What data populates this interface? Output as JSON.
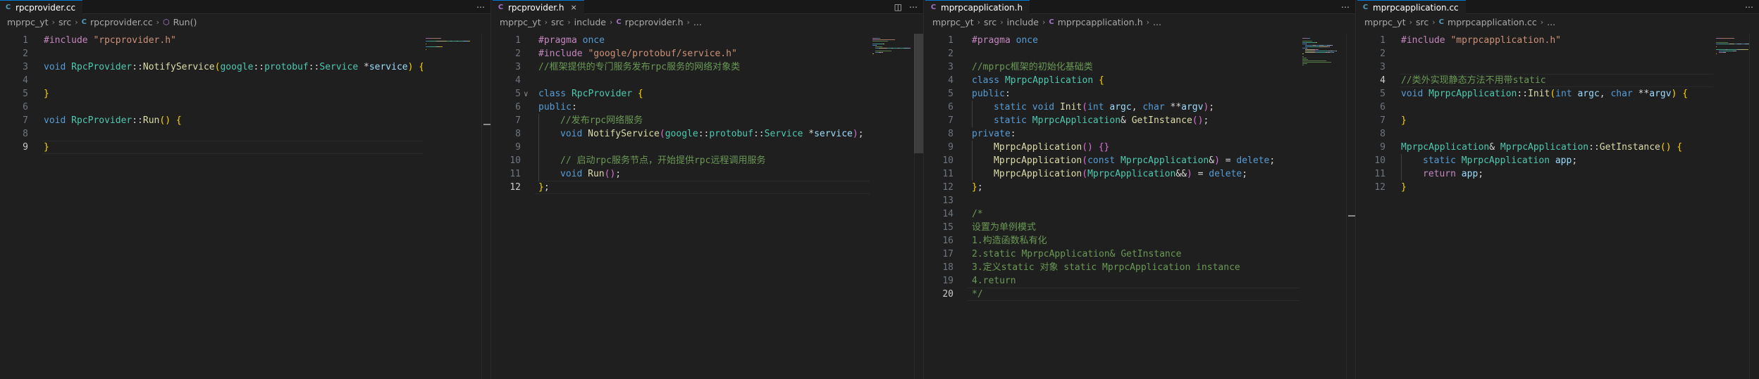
{
  "panes": [
    {
      "tab": {
        "icon": "C",
        "icon_kind": "cpp",
        "label": "rpcprovider.cc",
        "close": ""
      },
      "actions": [
        "⋯"
      ],
      "breadcrumb": [
        {
          "text": "mprpc_yt"
        },
        {
          "text": "src"
        },
        {
          "text": "rpcprovider.cc",
          "icon": "C",
          "icon_kind": "cpp"
        },
        {
          "text": "Run()",
          "icon": "⬡",
          "icon_kind": "sym"
        }
      ],
      "current_line": 9,
      "lines": [
        {
          "n": "1",
          "fold": "",
          "indent": 0,
          "tokens": [
            [
              "#include ",
              "pre"
            ],
            [
              "\"rpcprovider.h\"",
              "str"
            ]
          ]
        },
        {
          "n": "2",
          "fold": "",
          "indent": 0,
          "tokens": []
        },
        {
          "n": "3",
          "fold": "",
          "indent": 0,
          "tokens": [
            [
              "void ",
              "kw"
            ],
            [
              "RpcProvider",
              "ty"
            ],
            [
              "::",
              "pun"
            ],
            [
              "NotifyService",
              "fn"
            ],
            [
              "(",
              "br1"
            ],
            [
              "google",
              "ty"
            ],
            [
              "::",
              "pun"
            ],
            [
              "protobuf",
              "ty"
            ],
            [
              "::",
              "pun"
            ],
            [
              "Service ",
              "ty"
            ],
            [
              "*",
              "pun"
            ],
            [
              "service",
              "var"
            ],
            [
              ")",
              "br1"
            ],
            [
              " ",
              "pun"
            ],
            [
              "{",
              "br1"
            ]
          ]
        },
        {
          "n": "4",
          "fold": "",
          "indent": 0,
          "tokens": []
        },
        {
          "n": "5",
          "fold": "",
          "indent": 0,
          "tokens": [
            [
              "}",
              "br1"
            ]
          ]
        },
        {
          "n": "6",
          "fold": "",
          "indent": 0,
          "tokens": []
        },
        {
          "n": "7",
          "fold": "",
          "indent": 0,
          "tokens": [
            [
              "void ",
              "kw"
            ],
            [
              "RpcProvider",
              "ty"
            ],
            [
              "::",
              "pun"
            ],
            [
              "Run",
              "fn"
            ],
            [
              "()",
              "br1"
            ],
            [
              " ",
              "pun"
            ],
            [
              "{",
              "br1"
            ]
          ]
        },
        {
          "n": "8",
          "fold": "",
          "indent": 0,
          "tokens": []
        },
        {
          "n": "9",
          "fold": "",
          "indent": 0,
          "tokens": [
            [
              "}",
              "br1"
            ]
          ]
        }
      ]
    },
    {
      "tab": {
        "icon": "C",
        "icon_kind": "h",
        "label": "rpcprovider.h",
        "close": "×"
      },
      "actions": [
        "◫",
        "⋯"
      ],
      "breadcrumb": [
        {
          "text": "mprpc_yt"
        },
        {
          "text": "src"
        },
        {
          "text": "include"
        },
        {
          "text": "rpcprovider.h",
          "icon": "C",
          "icon_kind": "h"
        },
        {
          "text": "..."
        }
      ],
      "current_line": 12,
      "lines": [
        {
          "n": "1",
          "fold": "",
          "indent": 0,
          "tokens": [
            [
              "#pragma ",
              "pre"
            ],
            [
              "once",
              "kw"
            ]
          ]
        },
        {
          "n": "2",
          "fold": "",
          "indent": 0,
          "tokens": [
            [
              "#include ",
              "pre"
            ],
            [
              "\"google/protobuf/service.h\"",
              "str"
            ]
          ]
        },
        {
          "n": "3",
          "fold": "",
          "indent": 0,
          "tokens": [
            [
              "//框架提供的专门服务发布rpc服务的网络对象类",
              "com"
            ]
          ]
        },
        {
          "n": "4",
          "fold": "",
          "indent": 0,
          "tokens": []
        },
        {
          "n": "5",
          "fold": "∨",
          "indent": 0,
          "tokens": [
            [
              "class ",
              "kw"
            ],
            [
              "RpcProvider",
              "ty"
            ],
            [
              " ",
              "pun"
            ],
            [
              "{",
              "br1"
            ]
          ]
        },
        {
          "n": "6",
          "fold": "",
          "indent": 0,
          "tokens": [
            [
              "public",
              "kw"
            ],
            [
              ":",
              "pun"
            ]
          ]
        },
        {
          "n": "7",
          "fold": "",
          "indent": 1,
          "tokens": [
            [
              "//发布rpc网络服务",
              "com"
            ]
          ]
        },
        {
          "n": "8",
          "fold": "",
          "indent": 1,
          "tokens": [
            [
              "void ",
              "kw"
            ],
            [
              "NotifyService",
              "fn"
            ],
            [
              "(",
              "br2"
            ],
            [
              "google",
              "ty"
            ],
            [
              "::",
              "pun"
            ],
            [
              "protobuf",
              "ty"
            ],
            [
              "::",
              "pun"
            ],
            [
              "Service ",
              "ty"
            ],
            [
              "*",
              "pun"
            ],
            [
              "service",
              "var"
            ],
            [
              ")",
              "br2"
            ],
            [
              ";",
              "pun"
            ]
          ]
        },
        {
          "n": "9",
          "fold": "",
          "indent": 1,
          "tokens": []
        },
        {
          "n": "10",
          "fold": "",
          "indent": 1,
          "tokens": [
            [
              "// 启动rpc服务节点，开始提供rpc远程调用服务",
              "com"
            ]
          ]
        },
        {
          "n": "11",
          "fold": "",
          "indent": 1,
          "tokens": [
            [
              "void ",
              "kw"
            ],
            [
              "Run",
              "fn"
            ],
            [
              "()",
              "br2"
            ],
            [
              ";",
              "pun"
            ]
          ]
        },
        {
          "n": "12",
          "fold": "",
          "indent": 0,
          "tokens": [
            [
              "}",
              "br1"
            ],
            [
              ";",
              "pun"
            ]
          ]
        }
      ]
    },
    {
      "tab": {
        "icon": "C",
        "icon_kind": "h",
        "label": "mprpcapplication.h",
        "close": ""
      },
      "actions": [
        "⋯"
      ],
      "breadcrumb": [
        {
          "text": "mprpc_yt"
        },
        {
          "text": "src"
        },
        {
          "text": "include"
        },
        {
          "text": "mprpcapplication.h",
          "icon": "C",
          "icon_kind": "h"
        },
        {
          "text": "..."
        }
      ],
      "current_line": 20,
      "lines": [
        {
          "n": "1",
          "fold": "",
          "indent": 0,
          "tokens": [
            [
              "#pragma ",
              "pre"
            ],
            [
              "once",
              "kw"
            ]
          ]
        },
        {
          "n": "2",
          "fold": "",
          "indent": 0,
          "tokens": []
        },
        {
          "n": "3",
          "fold": "",
          "indent": 0,
          "tokens": [
            [
              "//mprpc框架的初始化基础类",
              "com"
            ]
          ]
        },
        {
          "n": "4",
          "fold": "",
          "indent": 0,
          "tokens": [
            [
              "class ",
              "kw"
            ],
            [
              "MprpcApplication",
              "ty"
            ],
            [
              " ",
              "pun"
            ],
            [
              "{",
              "br1"
            ]
          ]
        },
        {
          "n": "5",
          "fold": "",
          "indent": 0,
          "tokens": [
            [
              "public",
              "kw"
            ],
            [
              ":",
              "pun"
            ]
          ]
        },
        {
          "n": "6",
          "fold": "",
          "indent": 1,
          "tokens": [
            [
              "static ",
              "kw"
            ],
            [
              "void ",
              "kw"
            ],
            [
              "Init",
              "fn"
            ],
            [
              "(",
              "br2"
            ],
            [
              "int ",
              "kw"
            ],
            [
              "argc",
              "var"
            ],
            [
              ", ",
              "pun"
            ],
            [
              "char ",
              "kw"
            ],
            [
              "**",
              "pun"
            ],
            [
              "argv",
              "var"
            ],
            [
              ")",
              "br2"
            ],
            [
              ";",
              "pun"
            ]
          ]
        },
        {
          "n": "7",
          "fold": "",
          "indent": 1,
          "tokens": [
            [
              "static ",
              "kw"
            ],
            [
              "MprpcApplication",
              "ty"
            ],
            [
              "& ",
              "pun"
            ],
            [
              "GetInstance",
              "fn"
            ],
            [
              "()",
              "br2"
            ],
            [
              ";",
              "pun"
            ]
          ]
        },
        {
          "n": "8",
          "fold": "",
          "indent": 0,
          "tokens": [
            [
              "private",
              "kw"
            ],
            [
              ":",
              "pun"
            ]
          ]
        },
        {
          "n": "9",
          "fold": "",
          "indent": 1,
          "tokens": [
            [
              "MprpcApplication",
              "fn"
            ],
            [
              "()",
              "br2"
            ],
            [
              " ",
              "pun"
            ],
            [
              "{}",
              "br2"
            ]
          ]
        },
        {
          "n": "10",
          "fold": "",
          "indent": 1,
          "tokens": [
            [
              "MprpcApplication",
              "fn"
            ],
            [
              "(",
              "br2"
            ],
            [
              "const ",
              "kw"
            ],
            [
              "MprpcApplication",
              "ty"
            ],
            [
              "&",
              "pun"
            ],
            [
              ")",
              "br2"
            ],
            [
              " = ",
              "pun"
            ],
            [
              "delete",
              "kw"
            ],
            [
              ";",
              "pun"
            ]
          ]
        },
        {
          "n": "11",
          "fold": "",
          "indent": 1,
          "tokens": [
            [
              "MprpcApplication",
              "fn"
            ],
            [
              "(",
              "br2"
            ],
            [
              "MprpcApplication",
              "ty"
            ],
            [
              "&&",
              "pun"
            ],
            [
              ")",
              "br2"
            ],
            [
              " = ",
              "pun"
            ],
            [
              "delete",
              "kw"
            ],
            [
              ";",
              "pun"
            ]
          ]
        },
        {
          "n": "12",
          "fold": "",
          "indent": 0,
          "tokens": [
            [
              "}",
              "br1"
            ],
            [
              ";",
              "pun"
            ]
          ]
        },
        {
          "n": "13",
          "fold": "",
          "indent": 0,
          "tokens": []
        },
        {
          "n": "14",
          "fold": "",
          "indent": 0,
          "tokens": [
            [
              "/*",
              "com"
            ]
          ]
        },
        {
          "n": "15",
          "fold": "",
          "indent": 0,
          "tokens": [
            [
              "设置为单例模式",
              "com"
            ]
          ]
        },
        {
          "n": "16",
          "fold": "",
          "indent": 0,
          "tokens": [
            [
              "1.构造函数私有化",
              "com"
            ]
          ]
        },
        {
          "n": "17",
          "fold": "",
          "indent": 0,
          "tokens": [
            [
              "2.static MprpcApplication& GetInstance",
              "com"
            ]
          ]
        },
        {
          "n": "18",
          "fold": "",
          "indent": 0,
          "tokens": [
            [
              "3.定义static 对象 static MprpcApplication instance",
              "com"
            ]
          ]
        },
        {
          "n": "19",
          "fold": "",
          "indent": 0,
          "tokens": [
            [
              "4.return",
              "com"
            ]
          ]
        },
        {
          "n": "20",
          "fold": "",
          "indent": 0,
          "tokens": [
            [
              "*/",
              "com"
            ]
          ]
        }
      ]
    },
    {
      "tab": {
        "icon": "C",
        "icon_kind": "cpp",
        "label": "mprpcapplication.cc",
        "close": ""
      },
      "actions": [
        "⋯"
      ],
      "breadcrumb": [
        {
          "text": "mprpc_yt"
        },
        {
          "text": "src"
        },
        {
          "text": "mprpcapplication.cc",
          "icon": "C",
          "icon_kind": "cpp"
        },
        {
          "text": "..."
        }
      ],
      "current_line": 4,
      "lines": [
        {
          "n": "1",
          "fold": "",
          "indent": 0,
          "tokens": [
            [
              "#include ",
              "pre"
            ],
            [
              "\"mprpcapplication.h\"",
              "str"
            ]
          ]
        },
        {
          "n": "2",
          "fold": "",
          "indent": 0,
          "tokens": []
        },
        {
          "n": "3",
          "fold": "",
          "indent": 0,
          "tokens": []
        },
        {
          "n": "4",
          "fold": "",
          "indent": 0,
          "tokens": [
            [
              "//类外实现静态方法不用带static",
              "com"
            ]
          ]
        },
        {
          "n": "5",
          "fold": "",
          "indent": 0,
          "tokens": [
            [
              "void ",
              "kw"
            ],
            [
              "MprpcApplication",
              "ty"
            ],
            [
              "::",
              "pun"
            ],
            [
              "Init",
              "fn"
            ],
            [
              "(",
              "br1"
            ],
            [
              "int ",
              "kw"
            ],
            [
              "argc",
              "var"
            ],
            [
              ", ",
              "pun"
            ],
            [
              "char ",
              "kw"
            ],
            [
              "**",
              "pun"
            ],
            [
              "argv",
              "var"
            ],
            [
              ")",
              "br1"
            ],
            [
              " ",
              "pun"
            ],
            [
              "{",
              "br1"
            ]
          ]
        },
        {
          "n": "6",
          "fold": "",
          "indent": 0,
          "tokens": []
        },
        {
          "n": "7",
          "fold": "",
          "indent": 0,
          "tokens": [
            [
              "}",
              "br1"
            ]
          ]
        },
        {
          "n": "8",
          "fold": "",
          "indent": 0,
          "tokens": []
        },
        {
          "n": "9",
          "fold": "",
          "indent": 0,
          "tokens": [
            [
              "MprpcApplication",
              "ty"
            ],
            [
              "& ",
              "pun"
            ],
            [
              "MprpcApplication",
              "ty"
            ],
            [
              "::",
              "pun"
            ],
            [
              "GetInstance",
              "fn"
            ],
            [
              "()",
              "br1"
            ],
            [
              " ",
              "pun"
            ],
            [
              "{",
              "br1"
            ]
          ]
        },
        {
          "n": "10",
          "fold": "",
          "indent": 1,
          "tokens": [
            [
              "static ",
              "kw"
            ],
            [
              "MprpcApplication",
              "ty"
            ],
            [
              " ",
              "pun"
            ],
            [
              "app",
              "var"
            ],
            [
              ";",
              "pun"
            ]
          ]
        },
        {
          "n": "11",
          "fold": "",
          "indent": 1,
          "tokens": [
            [
              "return ",
              "pre"
            ],
            [
              "app",
              "var"
            ],
            [
              ";",
              "pun"
            ]
          ]
        },
        {
          "n": "12",
          "fold": "",
          "indent": 0,
          "tokens": [
            [
              "}",
              "br1"
            ]
          ]
        }
      ]
    }
  ],
  "colors": {
    "editor_bg": "#1f1f1f",
    "tabbar_bg": "#181818",
    "active_tab_border": "#0078d4",
    "line_number": "#6e7681",
    "line_number_active": "#cccccc"
  }
}
